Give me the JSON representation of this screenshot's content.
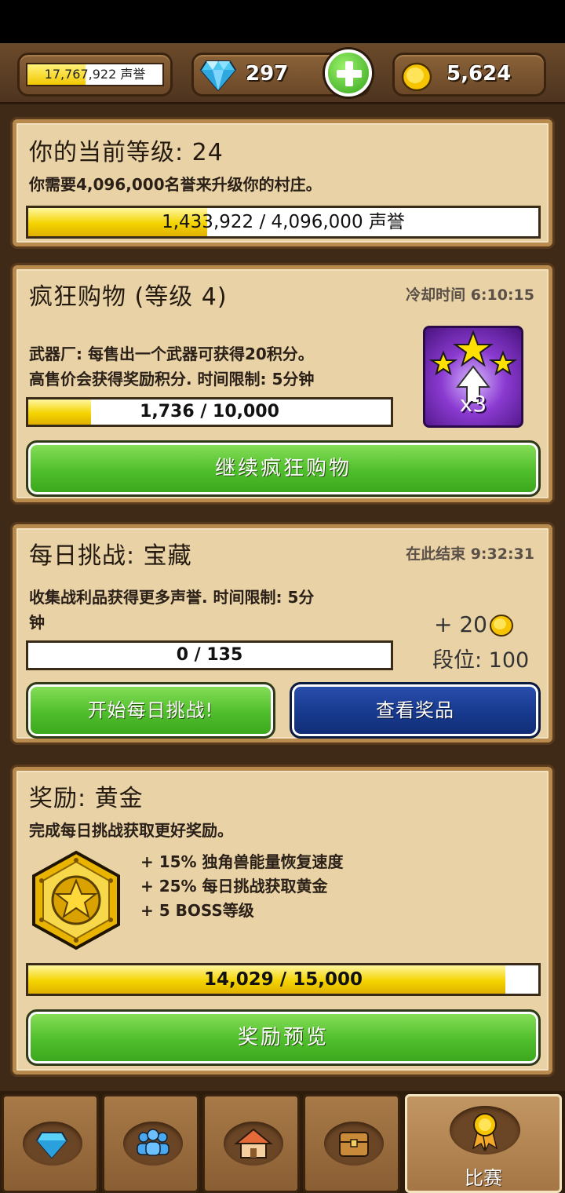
{
  "topbar": {
    "fame_text": "17,767,922 声誉",
    "fame_progress": 0.43,
    "gems": "297",
    "gold": "5,624"
  },
  "level_panel": {
    "title": "你的当前等级: 24",
    "desc": "你需要4,096,000名誉来升级你的村庄。",
    "progress_text": "1,433,922 / 4,096,000 声誉",
    "progress": 0.35
  },
  "crazy_shopping": {
    "title": "疯狂购物 (等级 4)",
    "cooldown": "冷却时间 6:10:15",
    "desc_line1": "武器厂: 每售出一个武器可获得20积分。",
    "desc_line2": "高售价会获得奖励积分. 时间限制: 5分钟",
    "progress_text": "1,736 / 10,000",
    "progress": 0.1736,
    "multiplier": "x3",
    "button": "继续疯狂购物"
  },
  "daily_challenge": {
    "title": "每日挑战: 宝藏",
    "ends": "在此结束 9:32:31",
    "desc_line1": "收集战利品获得更多声誉. 时间限制: 5分",
    "desc_line2": "钟",
    "progress_text": "0 / 135",
    "progress": 0,
    "reward_gold": "+ 20",
    "rank": "段位: 100",
    "start_button": "开始每日挑战!",
    "prizes_button": "查看奖品"
  },
  "reward_panel": {
    "title": "奖励: 黄金",
    "desc": "完成每日挑战获取更好奖励。",
    "bonuses": [
      "+ 15% 独角兽能量恢复速度",
      "+ 25% 每日挑战获取黄金",
      "+ 5 BOSS等级"
    ],
    "progress_text": "14,029 / 15,000",
    "progress": 0.9353,
    "button": "奖励预览"
  },
  "nav": {
    "active_label": "比赛"
  },
  "colors": {
    "wood_dark": "#3e2a17",
    "panel": "#e8d2a6",
    "green_button": "#4fbe2c",
    "blue_button": "#173a8e",
    "bar_fill": "#f4d400"
  }
}
